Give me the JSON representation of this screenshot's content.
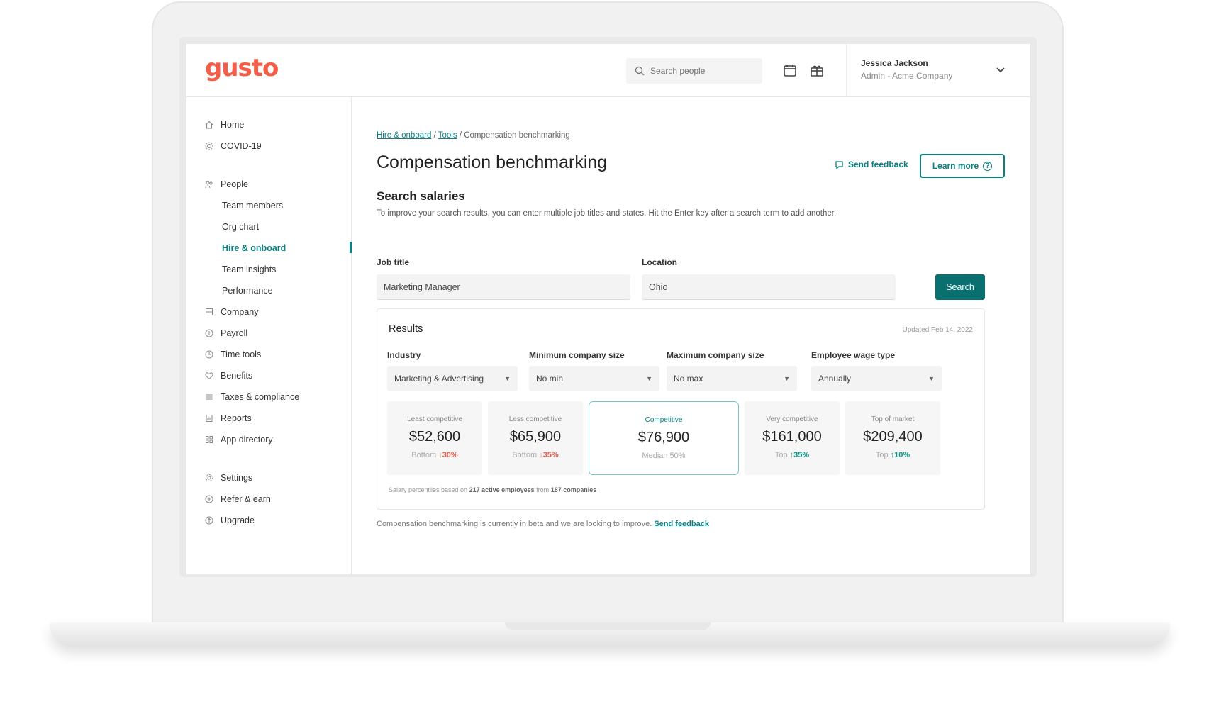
{
  "header": {
    "logo": "gusto",
    "search_placeholder": "Search people",
    "user_name": "Jessica Jackson",
    "user_role": "Admin - Acme Company",
    "icons": [
      "search-icon",
      "calendar-icon",
      "gift-icon",
      "chevron-down-icon"
    ]
  },
  "sidebar": {
    "items": [
      {
        "label": "Home",
        "icon": "home-icon"
      },
      {
        "label": "COVID-19",
        "icon": "sun-icon"
      },
      {
        "label": "People",
        "icon": "people-icon"
      },
      {
        "label": "Team members"
      },
      {
        "label": "Org chart"
      },
      {
        "label": "Hire & onboard",
        "active": true
      },
      {
        "label": "Team insights"
      },
      {
        "label": "Performance"
      },
      {
        "label": "Company",
        "icon": "building-icon"
      },
      {
        "label": "Payroll",
        "icon": "dollar-icon"
      },
      {
        "label": "Time tools",
        "icon": "clock-icon"
      },
      {
        "label": "Benefits",
        "icon": "heart-icon"
      },
      {
        "label": "Taxes & compliance",
        "icon": "list-icon"
      },
      {
        "label": "Reports",
        "icon": "report-icon"
      },
      {
        "label": "App directory",
        "icon": "grid-icon"
      },
      {
        "label": "Settings",
        "icon": "gear-icon"
      },
      {
        "label": "Refer & earn",
        "icon": "gift-icon"
      },
      {
        "label": "Upgrade",
        "icon": "upgrade-icon"
      }
    ]
  },
  "breadcrumb": {
    "link1": "Hire & onboard",
    "sep": "/",
    "link2": "Tools",
    "current": "/ Compensation benchmarking"
  },
  "page": {
    "title": "Compensation benchmarking",
    "send_feedback": "Send feedback",
    "learn_more": "Learn more",
    "section_title": "Search salaries",
    "section_desc": "To improve your search results, you can enter multiple job titles and states. Hit the Enter key after a search term to add another."
  },
  "search": {
    "job_label": "Job title",
    "job_value": "Marketing Manager",
    "location_label": "Location",
    "location_value": "Ohio",
    "button": "Search"
  },
  "results": {
    "title": "Results",
    "updated": "Updated Feb 14, 2022",
    "filters": [
      {
        "label": "Industry",
        "value": "Marketing & Advertising"
      },
      {
        "label": "Minimum company size",
        "value": "No min"
      },
      {
        "label": "Maximum company size",
        "value": "No max"
      },
      {
        "label": "Employee wage type",
        "value": "Annually"
      }
    ],
    "stats": [
      {
        "label": "Least competitive",
        "value": "$52,600",
        "sub_prefix": "Bottom",
        "sub_delta": "↓30%",
        "trend": "down"
      },
      {
        "label": "Less competitive",
        "value": "$65,900",
        "sub_prefix": "Bottom",
        "sub_delta": "↓35%",
        "trend": "down"
      },
      {
        "label": "Competitive",
        "value": "$76,900",
        "sub_prefix": "Median 50%",
        "sub_delta": "",
        "trend": "none"
      },
      {
        "label": "Very competitive",
        "value": "$161,000",
        "sub_prefix": "Top",
        "sub_delta": "↑35%",
        "trend": "up"
      },
      {
        "label": "Top of market",
        "value": "$209,400",
        "sub_prefix": "Top",
        "sub_delta": "↑10%",
        "trend": "up"
      }
    ],
    "footnote_prefix": "Salary percentiles based on",
    "footnote_employees": "217 active employees",
    "footnote_mid": "from",
    "footnote_companies": "187 companies"
  },
  "beta": {
    "text": "Compensation benchmarking is currently in beta and we are looking to improve.",
    "link": "Send feedback"
  },
  "colors": {
    "brand": "#f45d48",
    "accent": "#0a8080",
    "down": "#e05a4a",
    "up": "#0a9a8a"
  }
}
